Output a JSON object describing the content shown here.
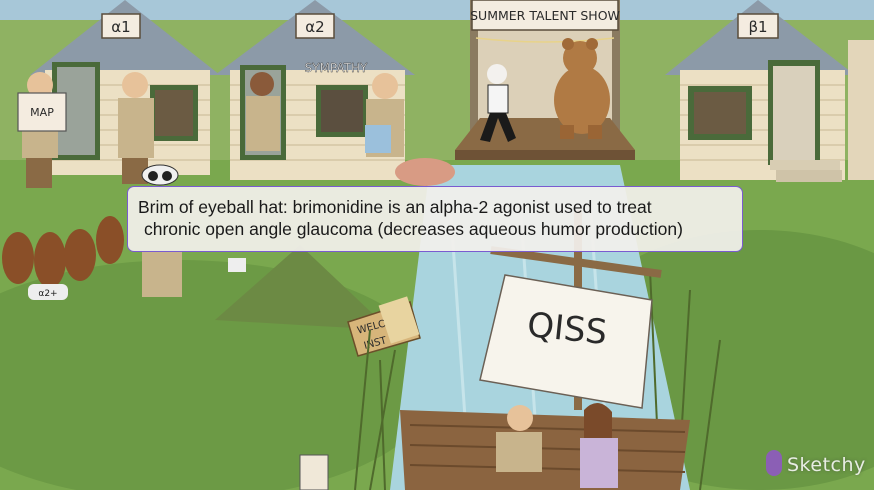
{
  "caption": {
    "line1": "Brim of eyeball hat: brimonidine is an alpha-2 agonist used to treat",
    "line2": "chronic open angle glaucoma (decreases aqueous humor production)"
  },
  "signs": {
    "cabin_alpha1": "α1",
    "cabin_alpha2": "α2",
    "cabin_beta1": "β1",
    "sympathy": "SYMPATHY",
    "talent_show": "SUMMER TALENT SHOW",
    "map": "MAP",
    "dog_tag": "α2+",
    "welcome": "WELC",
    "welcome2": "INST",
    "sail": "QISS"
  },
  "branding": {
    "watermark": "Sketchy"
  },
  "colors": {
    "grass": "#7aa84e",
    "cabin_wall": "#ece0c4",
    "cabin_roof": "#8c9aa8",
    "river": "#a9d4de",
    "caption_border": "#7a5bd0",
    "watermark_icon": "#8b5fb5"
  }
}
